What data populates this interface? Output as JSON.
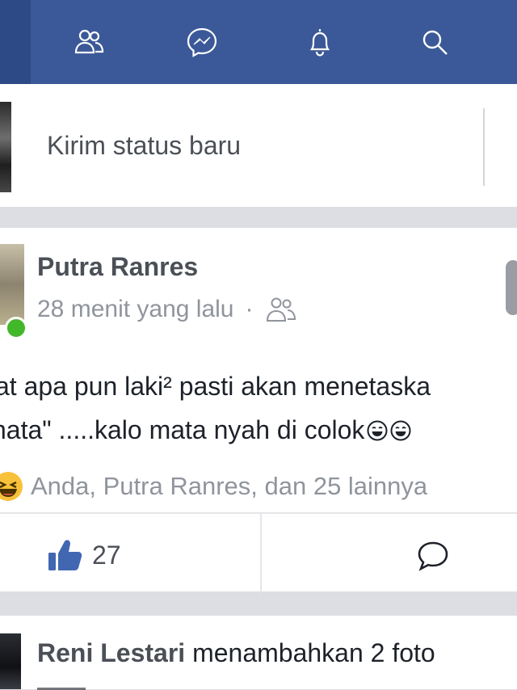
{
  "topbar": {
    "icons": [
      "friends-icon",
      "messenger-icon",
      "notifications-icon",
      "search-icon"
    ],
    "color": "#3b5998"
  },
  "composer": {
    "placeholder": "Kirim status baru"
  },
  "post": {
    "author": "Putra Ranres",
    "time": "28 menit yang lalu",
    "separator": "·",
    "audience_icon": "friends-icon",
    "text_line1": "at apa pun laki² pasti akan menetaska",
    "text_line2": "nata\" .....kalo mata nyah di colok",
    "reactions_text": "Anda, Putra Ranres, dan 25 lainnya",
    "reaction_icon": "haha-reaction-icon",
    "like_count": "27",
    "like_icon": "thumbs-up-icon",
    "comment_icon": "comment-icon"
  },
  "post2": {
    "author": "Reni Lestari",
    "action": " menambahkan 2 foto"
  }
}
